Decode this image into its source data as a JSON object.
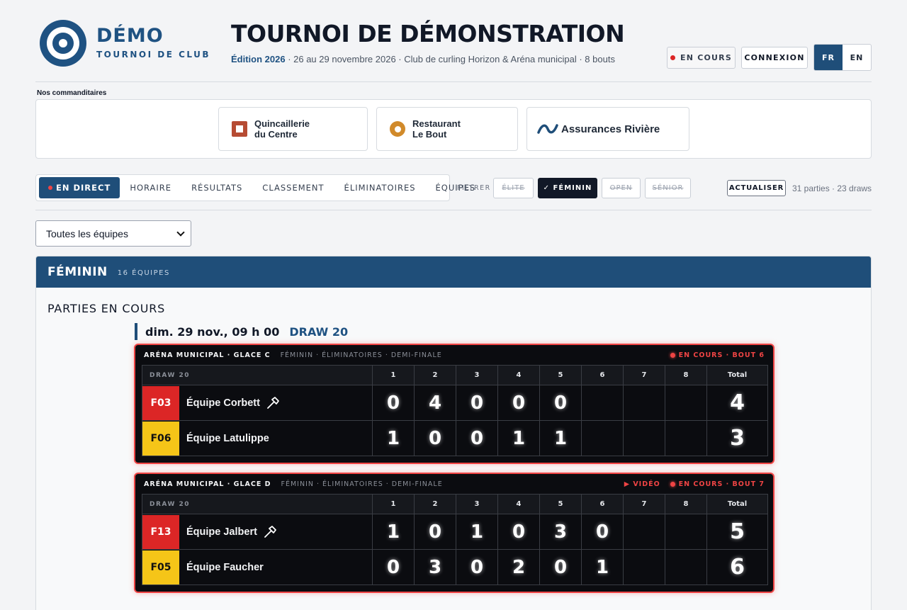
{
  "brand": {
    "name": "DÉMO",
    "sub": "TOURNOI DE CLUB"
  },
  "header": {
    "title": "TOURNOI DE DÉMONSTRATION",
    "edition": "Édition 2026",
    "details": " · 26 au 29 novembre 2026 · Club de curling Horizon & Aréna municipal · 8 bouts",
    "live_label": "EN COURS",
    "login_label": "CONNEXION",
    "lang": [
      "FR",
      "EN"
    ]
  },
  "sponsors": {
    "label": "Nos commanditaires",
    "items": [
      {
        "line1": "Quincaillerie",
        "line2": "du Centre"
      },
      {
        "line1": "Restaurant",
        "line2": "Le Bout"
      },
      {
        "name": "Assurances Rivière"
      }
    ]
  },
  "nav": {
    "tabs": [
      "EN DIRECT",
      "HORAIRE",
      "RÉSULTATS",
      "CLASSEMENT",
      "ÉLIMINATOIRES",
      "ÉQUIPES"
    ],
    "filter_label": "FILTRER",
    "filters": [
      {
        "label": "ÉLITE",
        "active": false
      },
      {
        "label": "✓ FÉMININ",
        "active": true
      },
      {
        "label": "OPEN",
        "active": false
      },
      {
        "label": "SÉNIOR",
        "active": false
      }
    ],
    "refresh_label": "ACTUALISER",
    "stats": "31 parties · 23 draws"
  },
  "team_select": {
    "value": "Toutes les équipes"
  },
  "section": {
    "title": "FÉMININ",
    "count": "16 ÉQUIPES",
    "subheading": "PARTIES EN COURS",
    "draw_date": "dim. 29 nov., 09 h 00",
    "draw_label": "DRAW 20"
  },
  "games": [
    {
      "venue": "ARÉNA MUNICIPAL · GLACE C",
      "phase": "FÉMININ · ÉLIMINATOIRES · DEMI-FINALE",
      "video": "",
      "status": "EN COURS · BOUT 6",
      "draw": "DRAW 20",
      "ends": [
        "1",
        "2",
        "3",
        "4",
        "5",
        "6",
        "7",
        "8"
      ],
      "total_label": "Total",
      "teams": [
        {
          "seed": "F03",
          "color": "red",
          "name": "Équipe Corbett",
          "hammer": true,
          "scores": [
            "0",
            "4",
            "0",
            "0",
            "0",
            "",
            "",
            ""
          ],
          "total": "4"
        },
        {
          "seed": "F06",
          "color": "yel",
          "name": "Équipe Latulippe",
          "hammer": false,
          "scores": [
            "1",
            "0",
            "0",
            "1",
            "1",
            "",
            "",
            ""
          ],
          "total": "3"
        }
      ]
    },
    {
      "venue": "ARÉNA MUNICIPAL · GLACE D",
      "phase": "FÉMININ · ÉLIMINATOIRES · DEMI-FINALE",
      "video": "▶ VIDÉO",
      "status": "EN COURS · BOUT 7",
      "draw": "DRAW 20",
      "ends": [
        "1",
        "2",
        "3",
        "4",
        "5",
        "6",
        "7",
        "8"
      ],
      "total_label": "Total",
      "teams": [
        {
          "seed": "F13",
          "color": "red",
          "name": "Équipe Jalbert",
          "hammer": true,
          "scores": [
            "1",
            "0",
            "1",
            "0",
            "3",
            "0",
            "",
            ""
          ],
          "total": "5"
        },
        {
          "seed": "F05",
          "color": "yel",
          "name": "Équipe Faucher",
          "hammer": false,
          "scores": [
            "0",
            "3",
            "0",
            "2",
            "0",
            "1",
            "",
            ""
          ],
          "total": "6"
        }
      ]
    }
  ]
}
